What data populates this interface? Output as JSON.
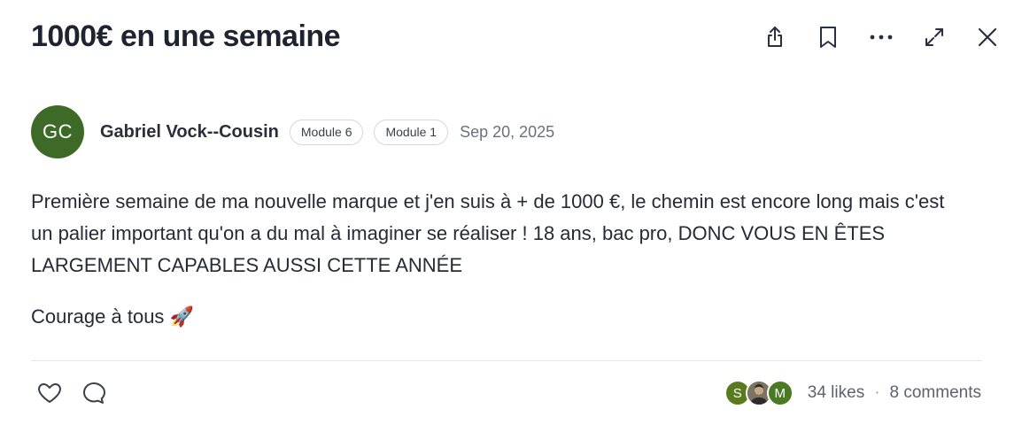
{
  "post": {
    "title": "1000€ en une semaine",
    "author": {
      "initials": "GC",
      "name": "Gabriel Vock--Cousin",
      "avatar_color": "#3d6b27"
    },
    "badges": [
      "Module 6",
      "Module 1"
    ],
    "date": "Sep 20, 2025",
    "body_paragraph_1": "Première semaine de ma nouvelle marque et j'en suis à + de 1000 €, le chemin est encore long mais c'est un palier important qu'on a du mal à imaginer se réaliser ! 18 ans, bac pro, DONC VOUS EN ÊTES LARGEMENT CAPABLES AUSSI CETTE ANNÉE",
    "body_paragraph_2": "Courage à tous 🚀"
  },
  "header_actions": [
    "share-icon",
    "bookmark-icon",
    "more-icon",
    "expand-icon",
    "close-icon"
  ],
  "footer": {
    "actions": [
      "heart-icon",
      "comment-icon"
    ],
    "likers": [
      {
        "initial": "S",
        "color": "#5a7a1f"
      },
      {
        "initial": "",
        "color": "#6b6b5c"
      },
      {
        "initial": "M",
        "color": "#4a7a23"
      }
    ],
    "likes_text": "34 likes",
    "separator": "·",
    "comments_text": "8 comments"
  }
}
